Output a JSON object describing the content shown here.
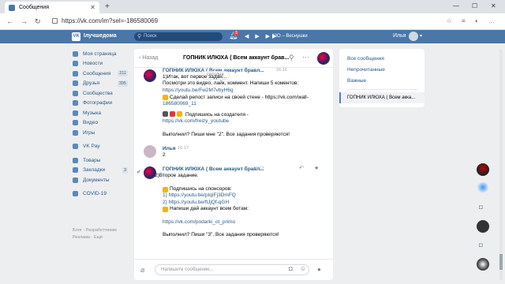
{
  "browser": {
    "tab_title": "Сообщения",
    "url": "https://vk.com/im?sel=-186580069"
  },
  "vk": {
    "logo": "VK",
    "brand": "Ілучшедома",
    "search_placeholder": "Поиск",
    "notif_count": "3",
    "track": "NIO – Веснушки",
    "username": "Илья"
  },
  "sidebar": {
    "items": [
      {
        "label": "Моя страница",
        "count": ""
      },
      {
        "label": "Новости",
        "count": ""
      },
      {
        "label": "Сообщения",
        "count": "211"
      },
      {
        "label": "Друзья",
        "count": "395"
      },
      {
        "label": "Сообщества",
        "count": ""
      },
      {
        "label": "Фотографии",
        "count": ""
      },
      {
        "label": "Музыка",
        "count": ""
      },
      {
        "label": "Видео",
        "count": ""
      },
      {
        "label": "Игры",
        "count": ""
      }
    ],
    "items2": [
      {
        "label": "VK Pay",
        "count": ""
      }
    ],
    "items3": [
      {
        "label": "Товары",
        "count": ""
      },
      {
        "label": "Закладки",
        "count": "3"
      },
      {
        "label": "Документы",
        "count": ""
      }
    ],
    "items4": [
      {
        "label": "COVID-19",
        "count": ""
      }
    ],
    "footer": [
      "Блог",
      "Разработчикам",
      "Реклама",
      "Ещё"
    ]
  },
  "chat": {
    "back": "Назад",
    "title": "ГОПНИК ИЛЮХА ( Всем аккаунт брав...",
    "date_pill": "сегодня",
    "msg1": {
      "name": "ГОПНИК ИЛЮХА ( Всем аккаунт бравл...",
      "time": "16:16",
      "lines": [
        "1)Итак, вот первое задан...",
        "Посмотри это видео, лайк, коммент. Напиши 5 коментов:",
        "https://youtu.be/Fw2M7vbyH6g",
        "Сделай репост записи на своей стене - https://vk.com/wall-",
        "186580069_11",
        "Подпишись на создателя -",
        "https://vk.com/freizy_youtube",
        "Выполнил? Пиши мне \"2\". Все задания проверяются!"
      ]
    },
    "msg2": {
      "name": "Илья",
      "time": "16:17",
      "text": "2"
    },
    "msg3": {
      "name": "ГОПНИК ИЛЮХА ( Всем аккаунт бравл...",
      "time": "16:17",
      "lines": [
        "2)Второе задание.",
        "Подпишись на спонсоров:",
        "1) https://youtu.be/pIqIFj3DmFQ",
        "2) https://youtu.be/flJjQf-qGH",
        "Напиши дай аккаунт всем ботам:",
        "https://vk.com/podarki_ot_primo",
        "Выполнил? Пиши \"3\". Все задания проверяются!"
      ]
    },
    "composer_placeholder": "Напишите сообщение..."
  },
  "right": {
    "tabs": [
      "Все сообщения",
      "Непрочитанные",
      "Важные"
    ],
    "active": "ГОПНИК ИЛЮХА ( Всем акка..."
  },
  "colors": {
    "vk_blue": "#4a76a8",
    "link": "#2a5885",
    "page_bg": "#edeef0"
  }
}
